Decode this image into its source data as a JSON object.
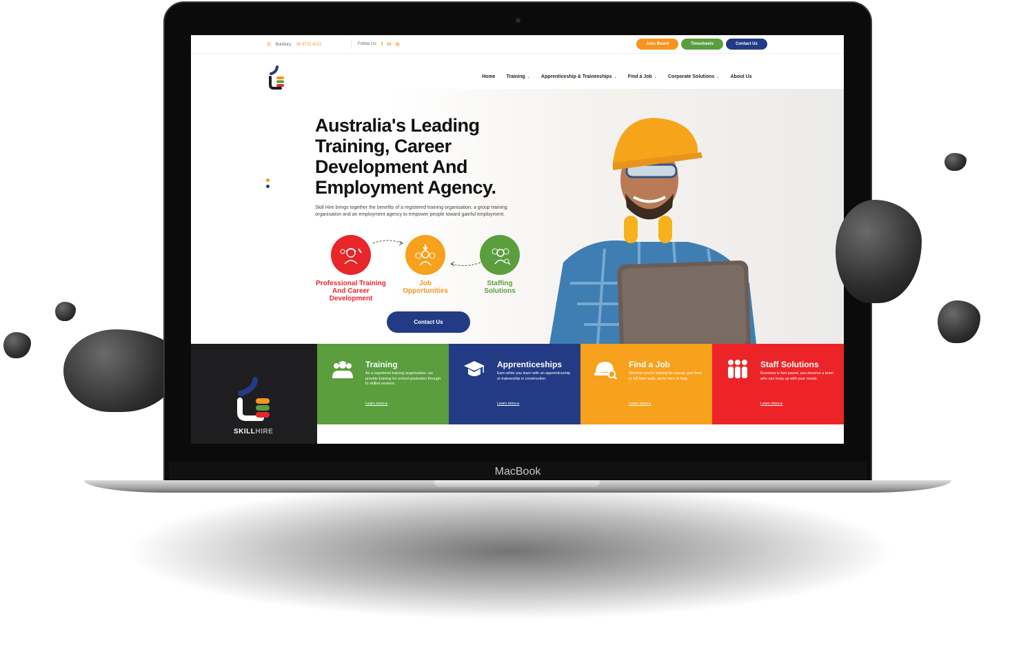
{
  "device": {
    "brand_label": "MacBook"
  },
  "topbar": {
    "phone_label": "Bunbury:",
    "phone_number": "08 9722 4222",
    "follow_label": "Follow Us:",
    "social": [
      "f",
      "in",
      "◎"
    ],
    "buttons": [
      {
        "label": "Jobs Board",
        "color": "#f7941d"
      },
      {
        "label": "Timesheets",
        "color": "#5a9e3e"
      },
      {
        "label": "Contact Us",
        "color": "#233b85"
      }
    ]
  },
  "nav": {
    "items": [
      {
        "label": "Home",
        "dropdown": false
      },
      {
        "label": "Training",
        "dropdown": true
      },
      {
        "label": "Apprenticeship & Traineeships",
        "dropdown": true
      },
      {
        "label": "Find a Job",
        "dropdown": true
      },
      {
        "label": "Corporate Solutions",
        "dropdown": true
      },
      {
        "label": "About Us",
        "dropdown": false
      }
    ]
  },
  "hero": {
    "title": "Australia's Leading Training, Career Development And Employment Agency.",
    "lead": "Skill Hire brings together the benefits of a registered training organisation, a group training organisation and an employment agency to empower people toward gainful employment.",
    "circles": [
      {
        "label": "Professional Training And Career Development",
        "color": "#e8262a"
      },
      {
        "label": "Job Opportunities",
        "color": "#f7941d"
      },
      {
        "label": "Staffing Solutions",
        "color": "#5a9e3e"
      }
    ],
    "cta_label": "Contact Us"
  },
  "tiles": {
    "logo_text_bold": "SKILL",
    "logo_text_light": "HIRE",
    "items": [
      {
        "title": "Training",
        "text": "As a registered training organisation, we provide training for school graduates through to skilled workers.",
        "link": "Learn more",
        "color": "#5a9e3e",
        "icon": "workers-hardhat-icon"
      },
      {
        "title": "Apprenticeships",
        "text": "Earn while you learn with an apprenticeship or traineeship in construction.",
        "link": "Learn more",
        "color": "#233b85",
        "icon": "graduation-cap-icon"
      },
      {
        "title": "Find a Job",
        "text": "Whether you're looking for casual, part time or full time work, we're here to help.",
        "link": "Learn more",
        "color": "#f7a11d",
        "icon": "hardhat-search-icon"
      },
      {
        "title": "Staff Solutions",
        "text": "Business is fast paced, you deserve a team who can keep up with your needs.",
        "link": "Learn more",
        "color": "#ec2427",
        "icon": "people-group-icon"
      }
    ]
  }
}
